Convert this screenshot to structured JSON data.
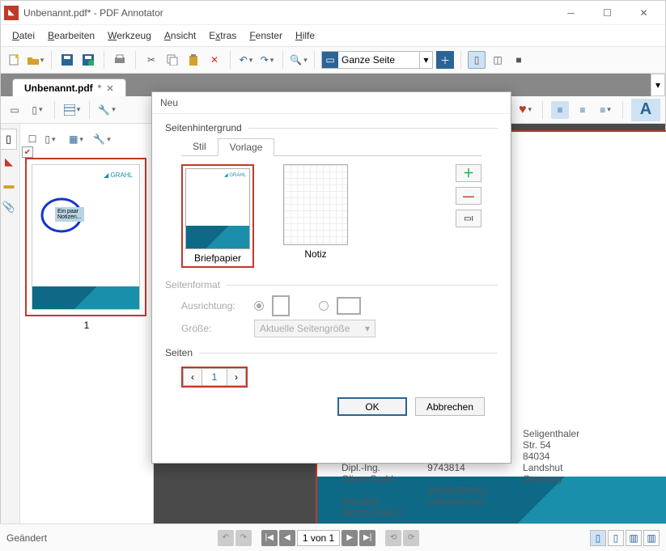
{
  "window": {
    "title": "Unbenannt.pdf* - PDF Annotator",
    "doc_tab": "Unbenannt.pdf",
    "status": "Geändert"
  },
  "menu": [
    "Datei",
    "Bearbeiten",
    "Werkzeug",
    "Ansicht",
    "Extras",
    "Fenster",
    "Hilfe"
  ],
  "toolbar": {
    "zoom_mode": "Ganze Seite"
  },
  "nav": {
    "page_indicator": "1 von 1"
  },
  "thumbs": {
    "page1_num": "1"
  },
  "dialog": {
    "title": "Neu",
    "section_background": "Seitenhintergrund",
    "tab_style": "Stil",
    "tab_template": "Vorlage",
    "templates": [
      {
        "name": "Briefpapier"
      },
      {
        "name": "Notiz"
      }
    ],
    "section_format": "Seitenformat",
    "orientation_label": "Ausrichtung:",
    "size_label": "Größe:",
    "size_value": "Aktuelle Seitengröße",
    "section_pages": "Seiten",
    "page_count": "1",
    "ok": "OK",
    "cancel": "Abbrechen"
  }
}
